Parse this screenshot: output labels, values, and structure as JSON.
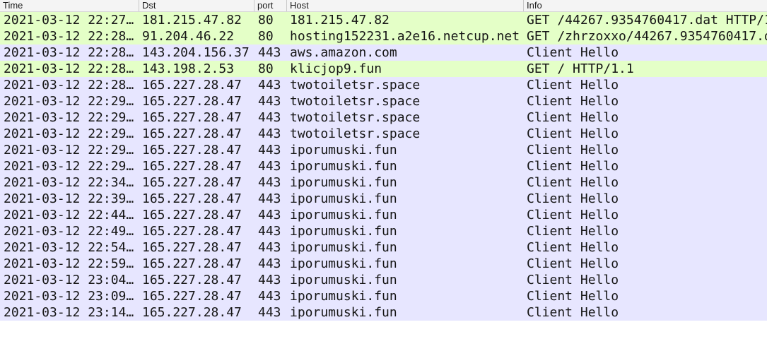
{
  "columns": {
    "time": "Time",
    "dst": "Dst",
    "port": "port",
    "host": "Host",
    "info": "Info"
  },
  "row_colors": {
    "http": "#e4ffc7",
    "tls": "#e7e6ff"
  },
  "rows": [
    {
      "protocol": "http",
      "time": "2021-03-12 22:27…",
      "dst": "181.215.47.82",
      "port": "80",
      "host": "181.215.47.82",
      "info": "GET /44267.9354760417.dat HTTP/1"
    },
    {
      "protocol": "http",
      "time": "2021-03-12 22:28…",
      "dst": "91.204.46.22",
      "port": "80",
      "host": "hosting152231.a2e16.netcup.net",
      "info": "GET /zhrzoxxo/44267.9354760417.d"
    },
    {
      "protocol": "tls",
      "time": "2021-03-12 22:28…",
      "dst": "143.204.156.37",
      "port": "443",
      "host": "aws.amazon.com",
      "info": "Client Hello"
    },
    {
      "protocol": "http",
      "time": "2021-03-12 22:28…",
      "dst": "143.198.2.53",
      "port": "80",
      "host": "klicjop9.fun",
      "info": "GET / HTTP/1.1"
    },
    {
      "protocol": "tls",
      "time": "2021-03-12 22:28…",
      "dst": "165.227.28.47",
      "port": "443",
      "host": "twotoiletsr.space",
      "info": "Client Hello"
    },
    {
      "protocol": "tls",
      "time": "2021-03-12 22:29…",
      "dst": "165.227.28.47",
      "port": "443",
      "host": "twotoiletsr.space",
      "info": "Client Hello"
    },
    {
      "protocol": "tls",
      "time": "2021-03-12 22:29…",
      "dst": "165.227.28.47",
      "port": "443",
      "host": "twotoiletsr.space",
      "info": "Client Hello"
    },
    {
      "protocol": "tls",
      "time": "2021-03-12 22:29…",
      "dst": "165.227.28.47",
      "port": "443",
      "host": "twotoiletsr.space",
      "info": "Client Hello"
    },
    {
      "protocol": "tls",
      "time": "2021-03-12 22:29…",
      "dst": "165.227.28.47",
      "port": "443",
      "host": "iporumuski.fun",
      "info": "Client Hello"
    },
    {
      "protocol": "tls",
      "time": "2021-03-12 22:29…",
      "dst": "165.227.28.47",
      "port": "443",
      "host": "iporumuski.fun",
      "info": "Client Hello"
    },
    {
      "protocol": "tls",
      "time": "2021-03-12 22:34…",
      "dst": "165.227.28.47",
      "port": "443",
      "host": "iporumuski.fun",
      "info": "Client Hello"
    },
    {
      "protocol": "tls",
      "time": "2021-03-12 22:39…",
      "dst": "165.227.28.47",
      "port": "443",
      "host": "iporumuski.fun",
      "info": "Client Hello"
    },
    {
      "protocol": "tls",
      "time": "2021-03-12 22:44…",
      "dst": "165.227.28.47",
      "port": "443",
      "host": "iporumuski.fun",
      "info": "Client Hello"
    },
    {
      "protocol": "tls",
      "time": "2021-03-12 22:49…",
      "dst": "165.227.28.47",
      "port": "443",
      "host": "iporumuski.fun",
      "info": "Client Hello"
    },
    {
      "protocol": "tls",
      "time": "2021-03-12 22:54…",
      "dst": "165.227.28.47",
      "port": "443",
      "host": "iporumuski.fun",
      "info": "Client Hello"
    },
    {
      "protocol": "tls",
      "time": "2021-03-12 22:59…",
      "dst": "165.227.28.47",
      "port": "443",
      "host": "iporumuski.fun",
      "info": "Client Hello"
    },
    {
      "protocol": "tls",
      "time": "2021-03-12 23:04…",
      "dst": "165.227.28.47",
      "port": "443",
      "host": "iporumuski.fun",
      "info": "Client Hello"
    },
    {
      "protocol": "tls",
      "time": "2021-03-12 23:09…",
      "dst": "165.227.28.47",
      "port": "443",
      "host": "iporumuski.fun",
      "info": "Client Hello"
    },
    {
      "protocol": "tls",
      "time": "2021-03-12 23:14…",
      "dst": "165.227.28.47",
      "port": "443",
      "host": "iporumuski.fun",
      "info": "Client Hello"
    }
  ]
}
